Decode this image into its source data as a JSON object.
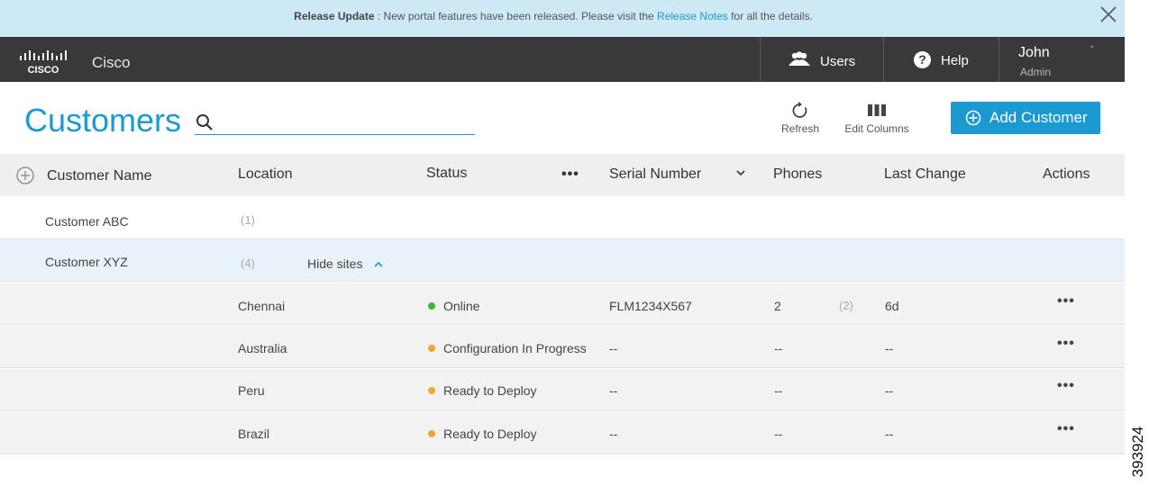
{
  "banner": {
    "title": "Release Update",
    "message_pre": " : New portal features have been released. Please visit the ",
    "link": "Release Notes",
    "message_post": " for all the details."
  },
  "topbar": {
    "brand": "Cisco",
    "users_label": "Users",
    "help_label": "Help",
    "user_name": "John",
    "user_role": "Admin",
    "user_chevron": "ˇ"
  },
  "page": {
    "title": "Customers",
    "search_placeholder": "",
    "refresh_label": "Refresh",
    "edit_columns_label": "Edit Columns",
    "add_customer_label": "Add Customer"
  },
  "table": {
    "headers": {
      "customer_name": "Customer Name",
      "location": "Location",
      "status": "Status",
      "status_menu": "•••",
      "serial_number": "Serial Number",
      "phones": "Phones",
      "last_change": "Last Change",
      "actions": "Actions"
    },
    "customers": [
      {
        "name": "Customer ABC",
        "count": "(1)"
      },
      {
        "name": "Customer XYZ",
        "count": "(4)",
        "toggle": "Hide sites"
      }
    ],
    "sites": [
      {
        "location": "Chennai",
        "status": "Online",
        "status_color": "#3eb53e",
        "serial": "FLM1234X567",
        "phones": "2",
        "phones_extra": "(2)",
        "last_change": "6d",
        "actions": "•••"
      },
      {
        "location": "Australia",
        "status": "Configuration In Progress",
        "status_color": "#f2a531",
        "serial": "--",
        "phones": "--",
        "phones_extra": "",
        "last_change": "--",
        "actions": "•••"
      },
      {
        "location": "Peru",
        "status": "Ready to Deploy",
        "status_color": "#f2a531",
        "serial": "--",
        "phones": "--",
        "phones_extra": "",
        "last_change": "--",
        "actions": "•••"
      },
      {
        "location": "Brazil",
        "status": "Ready to Deploy",
        "status_color": "#f2a531",
        "serial": "--",
        "phones": "--",
        "phones_extra": "",
        "last_change": "--",
        "actions": "•••"
      }
    ]
  },
  "figure_id": "393924",
  "colors": {
    "accent": "#1b9ad2",
    "topbar": "#39393b",
    "banner": "#cde9f6",
    "online": "#3eb53e",
    "pending": "#f2a531"
  }
}
